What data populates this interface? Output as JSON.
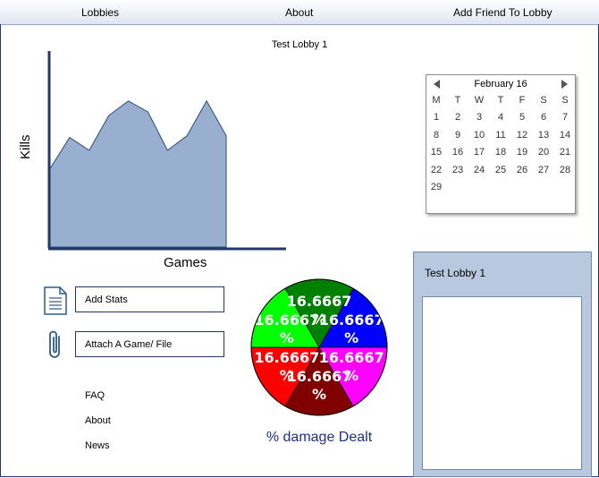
{
  "nav": {
    "lobbies": "Lobbies",
    "about": "About",
    "add_friend": "Add Friend To Lobby"
  },
  "lobby_title": "Test Lobby 1",
  "kills_chart": {
    "xlabel": "Games",
    "ylabel": "Kills",
    "fill_color": "#98afd0",
    "values": [
      43,
      60,
      53,
      72,
      80,
      74,
      53,
      61,
      80,
      61
    ]
  },
  "calendar": {
    "month_label": "February 16",
    "weekdays": [
      "M",
      "T",
      "W",
      "T",
      "F",
      "S",
      "S"
    ],
    "days": [
      "1",
      "2",
      "3",
      "4",
      "5",
      "6",
      "7",
      "8",
      "9",
      "10",
      "11",
      "12",
      "13",
      "14",
      "15",
      "16",
      "17",
      "18",
      "19",
      "20",
      "21",
      "22",
      "23",
      "24",
      "25",
      "26",
      "27",
      "28",
      "29"
    ]
  },
  "lobby_panel": {
    "title": "Test Lobby 1"
  },
  "actions": {
    "add_stats": "Add Stats",
    "attach": "Attach A Game/ File"
  },
  "links": [
    "FAQ",
    "About",
    "News"
  ],
  "chart_data": {
    "type": "pie",
    "title": "% damage Dealt",
    "slices": [
      {
        "value": 16.6667,
        "label": "16.6667 %",
        "color": "#0000ff"
      },
      {
        "value": 16.6667,
        "label": "16.6667 %",
        "color": "#ff00ff"
      },
      {
        "value": 16.6667,
        "label": "16.6667 %",
        "color": "#800000"
      },
      {
        "value": 16.6667,
        "label": "16.6667 %",
        "color": "#ff0000"
      },
      {
        "value": 16.6667,
        "label": "16.6667 %",
        "color": "#00ff00"
      },
      {
        "value": 16.6667,
        "label": "16.6667 %",
        "color": "#008000"
      }
    ]
  }
}
